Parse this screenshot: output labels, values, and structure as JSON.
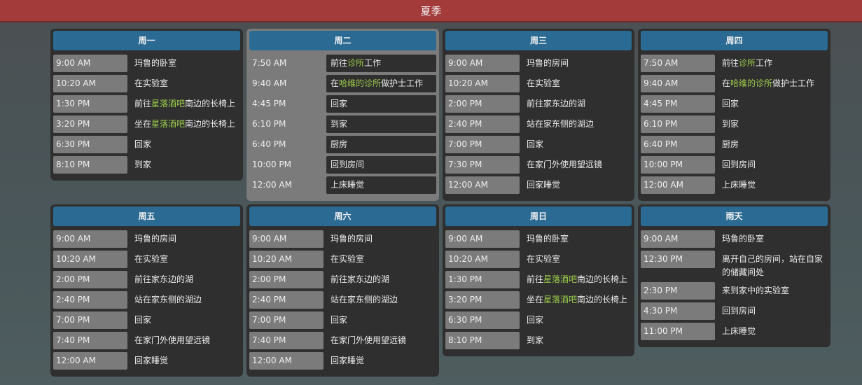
{
  "header": {
    "title": "夏季"
  },
  "colors": {
    "header": "#a33b3b",
    "day_title": "#2a6a93",
    "location_highlight": "#9ccc4a"
  },
  "days": [
    {
      "title": "周一",
      "rows": [
        {
          "time": "9:00 AM",
          "parts": [
            {
              "text": "玛鲁的卧室"
            }
          ]
        },
        {
          "time": "10:20 AM",
          "parts": [
            {
              "text": "在实验室"
            }
          ]
        },
        {
          "time": "1:30 PM",
          "parts": [
            {
              "text": "前往"
            },
            {
              "text": "星落酒吧",
              "hl": true
            },
            {
              "text": "南边的长椅上"
            }
          ]
        },
        {
          "time": "3:20 PM",
          "parts": [
            {
              "text": "坐在"
            },
            {
              "text": "星落酒吧",
              "hl": true
            },
            {
              "text": "南边的长椅上"
            }
          ]
        },
        {
          "time": "6:30 PM",
          "parts": [
            {
              "text": "回家"
            }
          ]
        },
        {
          "time": "8:10 PM",
          "parts": [
            {
              "text": "到家"
            }
          ]
        }
      ]
    },
    {
      "title": "周二",
      "highlight": true,
      "rows": [
        {
          "time": "7:50 AM",
          "parts": [
            {
              "text": "前往"
            },
            {
              "text": "诊所",
              "hl": true
            },
            {
              "text": "工作"
            }
          ]
        },
        {
          "time": "9:40 AM",
          "parts": [
            {
              "text": "在"
            },
            {
              "text": "哈维的诊所",
              "hl": true
            },
            {
              "text": "做护士工作"
            }
          ]
        },
        {
          "time": "4:45 PM",
          "parts": [
            {
              "text": "回家"
            }
          ]
        },
        {
          "time": "6:10 PM",
          "parts": [
            {
              "text": "到家"
            }
          ]
        },
        {
          "time": "6:40 PM",
          "parts": [
            {
              "text": "厨房"
            }
          ]
        },
        {
          "time": "10:00 PM",
          "parts": [
            {
              "text": "回到房间"
            }
          ]
        },
        {
          "time": "12:00 AM",
          "parts": [
            {
              "text": "上床睡觉"
            }
          ]
        }
      ]
    },
    {
      "title": "周三",
      "rows": [
        {
          "time": "9:00 AM",
          "parts": [
            {
              "text": "玛鲁的房间"
            }
          ]
        },
        {
          "time": "10:20 AM",
          "parts": [
            {
              "text": "在实验室"
            }
          ]
        },
        {
          "time": "2:00 PM",
          "parts": [
            {
              "text": "前往家东边的湖"
            }
          ]
        },
        {
          "time": "2:40 PM",
          "parts": [
            {
              "text": "站在家东侧的湖边"
            }
          ]
        },
        {
          "time": "7:00 PM",
          "parts": [
            {
              "text": "回家"
            }
          ]
        },
        {
          "time": "7:30 PM",
          "parts": [
            {
              "text": "在家门外使用望远镜"
            }
          ]
        },
        {
          "time": "12:00 AM",
          "parts": [
            {
              "text": "回家睡觉"
            }
          ]
        }
      ]
    },
    {
      "title": "周四",
      "rows": [
        {
          "time": "7:50 AM",
          "parts": [
            {
              "text": "前往"
            },
            {
              "text": "诊所",
              "hl": true
            },
            {
              "text": "工作"
            }
          ]
        },
        {
          "time": "9:40 AM",
          "parts": [
            {
              "text": "在"
            },
            {
              "text": "哈维的诊所",
              "hl": true
            },
            {
              "text": "做护士工作"
            }
          ]
        },
        {
          "time": "4:45 PM",
          "parts": [
            {
              "text": "回家"
            }
          ]
        },
        {
          "time": "6:10 PM",
          "parts": [
            {
              "text": "到家"
            }
          ]
        },
        {
          "time": "6:40 PM",
          "parts": [
            {
              "text": "厨房"
            }
          ]
        },
        {
          "time": "10:00 PM",
          "parts": [
            {
              "text": "回到房间"
            }
          ]
        },
        {
          "time": "12:00 AM",
          "parts": [
            {
              "text": "上床睡觉"
            }
          ]
        }
      ]
    },
    {
      "title": "周五",
      "rows": [
        {
          "time": "9:00 AM",
          "parts": [
            {
              "text": "玛鲁的房间"
            }
          ]
        },
        {
          "time": "10:20 AM",
          "parts": [
            {
              "text": "在实验室"
            }
          ]
        },
        {
          "time": "2:00 PM",
          "parts": [
            {
              "text": "前往家东边的湖"
            }
          ]
        },
        {
          "time": "2:40 PM",
          "parts": [
            {
              "text": "站在家东侧的湖边"
            }
          ]
        },
        {
          "time": "7:00 PM",
          "parts": [
            {
              "text": "回家"
            }
          ]
        },
        {
          "time": "7:40 PM",
          "parts": [
            {
              "text": "在家门外使用望远镜"
            }
          ]
        },
        {
          "time": "12:00 AM",
          "parts": [
            {
              "text": "回家睡觉"
            }
          ]
        }
      ]
    },
    {
      "title": "周六",
      "rows": [
        {
          "time": "9:00 AM",
          "parts": [
            {
              "text": "玛鲁的房间"
            }
          ]
        },
        {
          "time": "10:20 AM",
          "parts": [
            {
              "text": "在实验室"
            }
          ]
        },
        {
          "time": "2:00 PM",
          "parts": [
            {
              "text": "前往家东边的湖"
            }
          ]
        },
        {
          "time": "2:40 PM",
          "parts": [
            {
              "text": "站在家东侧的湖边"
            }
          ]
        },
        {
          "time": "7:00 PM",
          "parts": [
            {
              "text": "回家"
            }
          ]
        },
        {
          "time": "7:40 PM",
          "parts": [
            {
              "text": "在家门外使用望远镜"
            }
          ]
        },
        {
          "time": "12:00 AM",
          "parts": [
            {
              "text": "回家睡觉"
            }
          ]
        }
      ]
    },
    {
      "title": "周日",
      "rows": [
        {
          "time": "9:00 AM",
          "parts": [
            {
              "text": "玛鲁的卧室"
            }
          ]
        },
        {
          "time": "10:20 AM",
          "parts": [
            {
              "text": "在实验室"
            }
          ]
        },
        {
          "time": "1:30 PM",
          "parts": [
            {
              "text": "前往"
            },
            {
              "text": "星落酒吧",
              "hl": true
            },
            {
              "text": "南边的长椅上"
            }
          ]
        },
        {
          "time": "3:20 PM",
          "parts": [
            {
              "text": "坐在"
            },
            {
              "text": "星落酒吧",
              "hl": true
            },
            {
              "text": "南边的长椅上"
            }
          ]
        },
        {
          "time": "6:30 PM",
          "parts": [
            {
              "text": "回家"
            }
          ]
        },
        {
          "time": "8:10 PM",
          "parts": [
            {
              "text": "到家"
            }
          ]
        }
      ]
    },
    {
      "title": "雨天",
      "rows": [
        {
          "time": "9:00 AM",
          "parts": [
            {
              "text": "玛鲁的卧室"
            }
          ]
        },
        {
          "time": "12:30 PM",
          "multi": true,
          "parts": [
            {
              "text": "离开自己的房间，站在自家的储藏间处"
            }
          ]
        },
        {
          "time": "2:30 PM",
          "parts": [
            {
              "text": "来到家中的实验室"
            }
          ]
        },
        {
          "time": "4:30 PM",
          "parts": [
            {
              "text": "回到房间"
            }
          ]
        },
        {
          "time": "11:00 PM",
          "parts": [
            {
              "text": "上床睡觉"
            }
          ]
        }
      ]
    }
  ]
}
